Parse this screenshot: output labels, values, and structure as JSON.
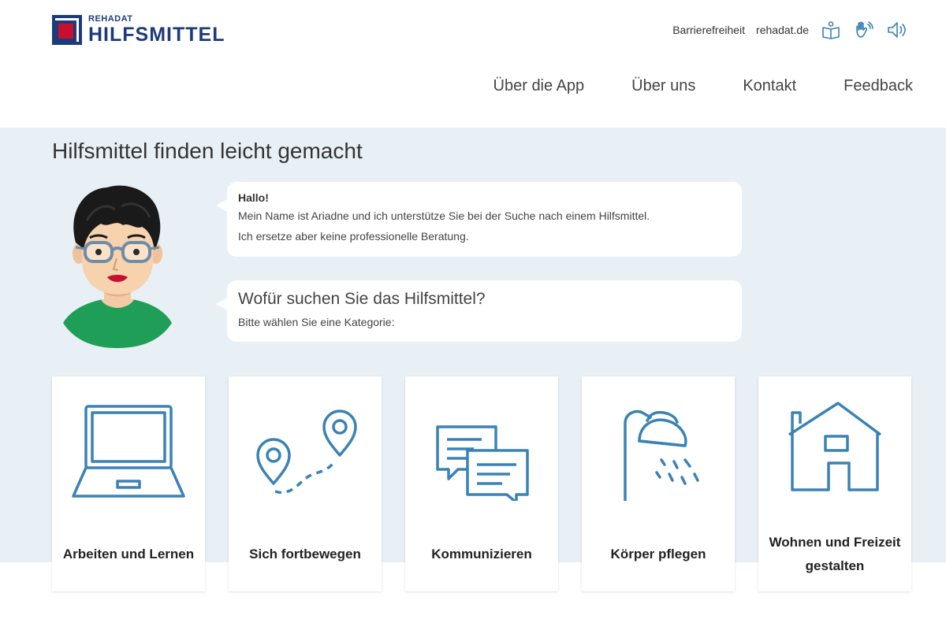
{
  "brand": {
    "small": "REHADAT",
    "big": "HILFSMITTEL",
    "colors": {
      "navy": "#1d3b7a",
      "red": "#c8102e",
      "icon": "#3a82b5",
      "band": "#e8f0f6"
    }
  },
  "utility": {
    "links": [
      "Barrierefreiheit",
      "rehadat.de"
    ],
    "icons": [
      "easy-language-icon",
      "sign-language-icon",
      "speaker-icon"
    ]
  },
  "nav": {
    "items": [
      "Über die App",
      "Über uns",
      "Kontakt",
      "Feedback"
    ]
  },
  "main": {
    "title": "Hilfsmittel finden leicht gemacht",
    "intro": {
      "hello": "Hallo!",
      "line1": "Mein Name ist Ariadne und ich unterstütze Sie bei der Suche nach einem Hilfsmittel.",
      "line2": "Ich ersetze aber keine professionelle Beratung."
    },
    "question": {
      "title": "Wofür suchen Sie das Hilfsmittel?",
      "subtitle": "Bitte wählen Sie eine Kategorie:"
    }
  },
  "categories": [
    {
      "label": "Arbeiten und Lernen",
      "icon": "laptop-icon"
    },
    {
      "label": "Sich fortbewegen",
      "icon": "route-pins-icon"
    },
    {
      "label": "Kommunizieren",
      "icon": "chat-bubbles-icon"
    },
    {
      "label": "Körper pflegen",
      "icon": "shower-icon"
    },
    {
      "label": "Wohnen und Freizeit gestalten",
      "icon": "house-icon"
    }
  ]
}
